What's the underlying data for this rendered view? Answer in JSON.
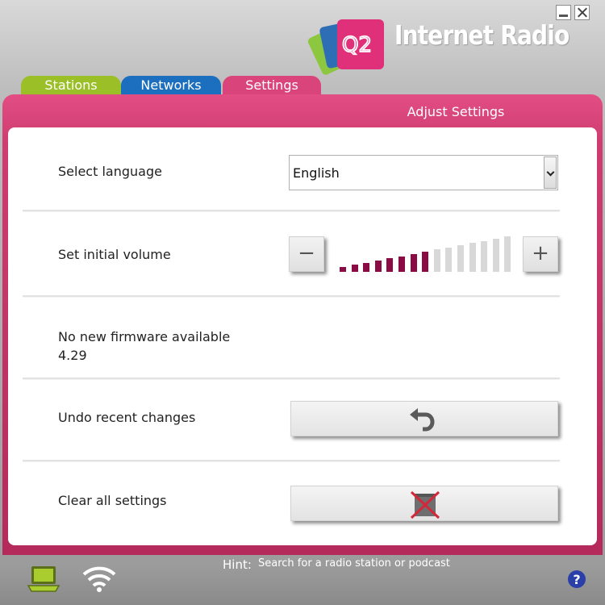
{
  "app": {
    "title": "Internet Radio",
    "logo_text": "Q2"
  },
  "window_controls": {
    "minimize_icon": "minimize-icon",
    "close_icon": "close-icon"
  },
  "tabs": [
    {
      "label": "Stations",
      "color": "#9bbf26"
    },
    {
      "label": "Networks",
      "color": "#1c6fbf"
    },
    {
      "label": "Settings",
      "color": "#d9447a",
      "active": true
    }
  ],
  "panel": {
    "title": "Adjust Settings"
  },
  "settings": {
    "language": {
      "label": "Select language",
      "selected": "English"
    },
    "volume": {
      "label": "Set initial volume",
      "minus": "−",
      "plus": "+",
      "level": 8,
      "max": 15
    },
    "firmware": {
      "status": "No new firmware available",
      "version": "4.29"
    },
    "undo": {
      "label": "Undo recent changes",
      "icon": "undo-icon"
    },
    "clear": {
      "label": "Clear all settings",
      "icon": "clear-icon"
    }
  },
  "footer": {
    "hint_label": "Hint:",
    "hint_text": "Search for a radio station or podcast",
    "icons": [
      "laptop-icon",
      "wifi-icon",
      "help-icon"
    ]
  },
  "colors": {
    "accent": "#d9447a",
    "volume_active": "#8b0c44",
    "volume_inactive": "#d8d8d8"
  }
}
